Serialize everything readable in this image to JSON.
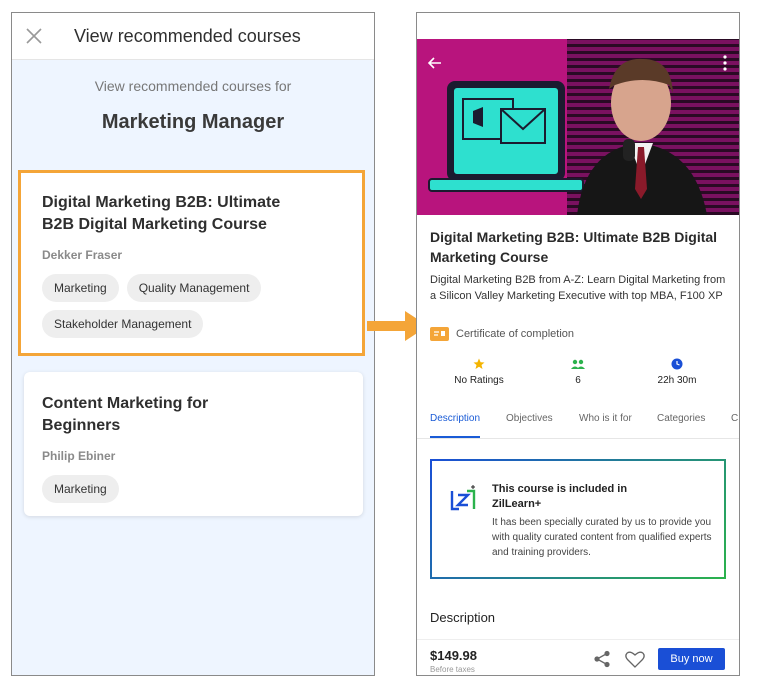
{
  "left": {
    "header_title": "View recommended courses",
    "subtitle": "View recommended courses for",
    "role": "Marketing Manager",
    "cards": [
      {
        "title": "Digital Marketing B2B: Ultimate B2B Digital Marketing Course",
        "author": "Dekker Fraser",
        "tags": [
          "Marketing",
          "Quality Management",
          "Stakeholder Management"
        ]
      },
      {
        "title": "Content Marketing for Beginners",
        "author": "Philip Ebiner",
        "tags": [
          "Marketing"
        ]
      }
    ]
  },
  "right": {
    "title": "Digital Marketing B2B: Ultimate B2B Digital Marketing Course",
    "description": "Digital Marketing B2B from A-Z: Learn Digital Marketing from a Silicon Valley Marketing Executive with top MBA, F100 XP",
    "certificate": "Certificate of completion",
    "stats": {
      "ratings": "No Ratings",
      "learners": "6",
      "duration": "22h 30m"
    },
    "tabs": [
      "Description",
      "Objectives",
      "Who is it for",
      "Categories",
      "C"
    ],
    "zillearn": {
      "line1": "This course is included in",
      "line2": "ZilLearn+",
      "body": "It has been specially curated by us to provide you with quality curated content from qualified experts and training providers."
    },
    "desc_heading": "Description",
    "price": "$149.98",
    "price_note": "Before taxes",
    "buy_label": "Buy now"
  },
  "colors": {
    "accent_orange": "#f4a538",
    "primary_blue": "#1a4fd6",
    "hero_magenta": "#b8147d",
    "screen_bg": "#eef5ff"
  }
}
